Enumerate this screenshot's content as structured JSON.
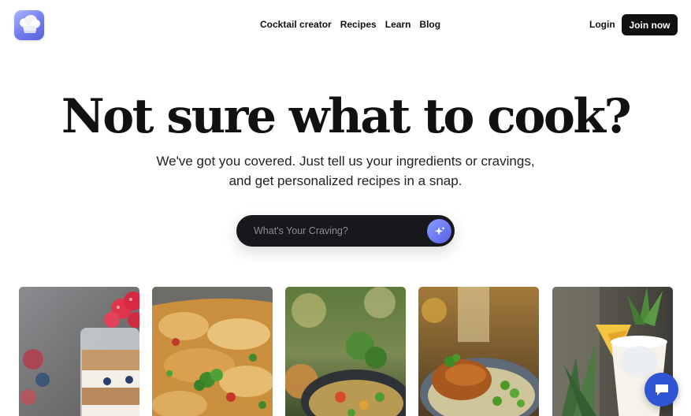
{
  "nav": {
    "links": [
      "Cocktail creator",
      "Recipes",
      "Learn",
      "Blog"
    ],
    "login_label": "Login",
    "join_label": "Join now"
  },
  "hero": {
    "title": "Not sure what to cook?",
    "subtitle_line1": "We've got you covered. Just tell us your ingredients or cravings,",
    "subtitle_line2": "and get personalized recipes in a snap."
  },
  "search": {
    "placeholder": "What's Your Craving?",
    "button_icon": "sparkle-icon"
  },
  "cards": [
    {
      "image": "yogurt-parfait-with-raspberries"
    },
    {
      "image": "baked-pasta-casserole"
    },
    {
      "image": "pan-of-vegetable-dish"
    },
    {
      "image": "roast-chicken-with-peas"
    },
    {
      "image": "pina-colada-cocktail"
    }
  ],
  "chat": {
    "icon": "chat-bubble-icon"
  },
  "colors": {
    "accent": "#6b76f0",
    "dark": "#111111",
    "chat": "#2f55d4"
  }
}
